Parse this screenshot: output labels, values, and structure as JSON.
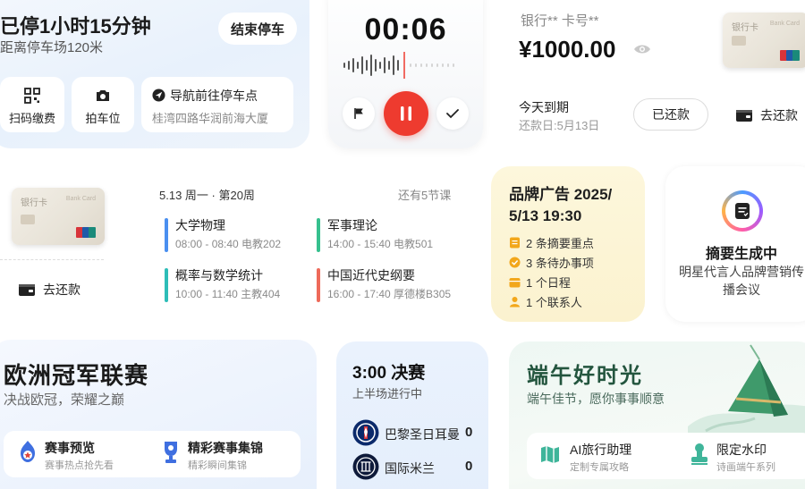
{
  "parking": {
    "title": "已停1小时15分钟",
    "distance": "距离停车场120米",
    "end_button": "结束停车",
    "scan_pay": "扫码缴费",
    "photo_spot": "拍车位",
    "navigate_label": "导航前往停车点",
    "navigate_address": "桂湾四路华润前海大厦"
  },
  "recorder": {
    "time": "00:06"
  },
  "bank": {
    "header": "银行**  卡号**",
    "amount": "¥1000.00",
    "due_title": "今天到期",
    "due_date": "还款日:5月13日",
    "repaid_button": "已还款",
    "go_repay": "去还款",
    "card_name": "银行卡",
    "card_type": "Bank Card"
  },
  "repay_card": {
    "go_repay": "去还款",
    "card_name": "银行卡",
    "card_type": "Bank Card"
  },
  "schedule": {
    "date": "5.13 周一 · 第20周",
    "remaining": "还有5节课",
    "courses": [
      {
        "name": "大学物理",
        "time": "08:00 - 08:40  电教202",
        "color": "#4a8ff0"
      },
      {
        "name": "军事理论",
        "time": "14:00 - 15:40  电教501",
        "color": "#36c08e"
      },
      {
        "name": "概率与数学统计",
        "time": "10:00 - 11:40  主教404",
        "color": "#2dbdb8"
      },
      {
        "name": "中国近代史纲要",
        "time": "16:00 - 17:40  厚德楼B305",
        "color": "#ee6a5a"
      }
    ]
  },
  "brand_ad": {
    "title": "品牌广告 2025/ 5/13 19:30",
    "items": [
      "2 条摘要重点",
      "3 条待办事项",
      "1 个日程",
      "1 个联系人"
    ]
  },
  "summary": {
    "title": "摘要生成中",
    "subtitle": "明星代言人品牌营销传播会议"
  },
  "ucl": {
    "title": "欧洲冠军联赛",
    "subtitle": "决战欧冠，荣耀之巅",
    "preview_title": "赛事预览",
    "preview_sub": "赛事热点抢先看",
    "highlights_title": "精彩赛事集锦",
    "highlights_sub": "精彩瞬间集锦"
  },
  "match": {
    "title": "3:00 决赛",
    "status": "上半场进行中",
    "teams": [
      {
        "name": "巴黎圣日耳曼",
        "score": "0"
      },
      {
        "name": "国际米兰",
        "score": "0"
      }
    ]
  },
  "dragon": {
    "title": "端午好时光",
    "subtitle": "端午佳节，愿你事事顺意",
    "ai_title": "AI旅行助理",
    "ai_sub": "定制专属攻略",
    "wm_title": "限定水印",
    "wm_sub": "诗画端午系列"
  },
  "colors": {
    "accent_red": "#ee3b2f",
    "ad_yellow": "#f2a71b"
  }
}
